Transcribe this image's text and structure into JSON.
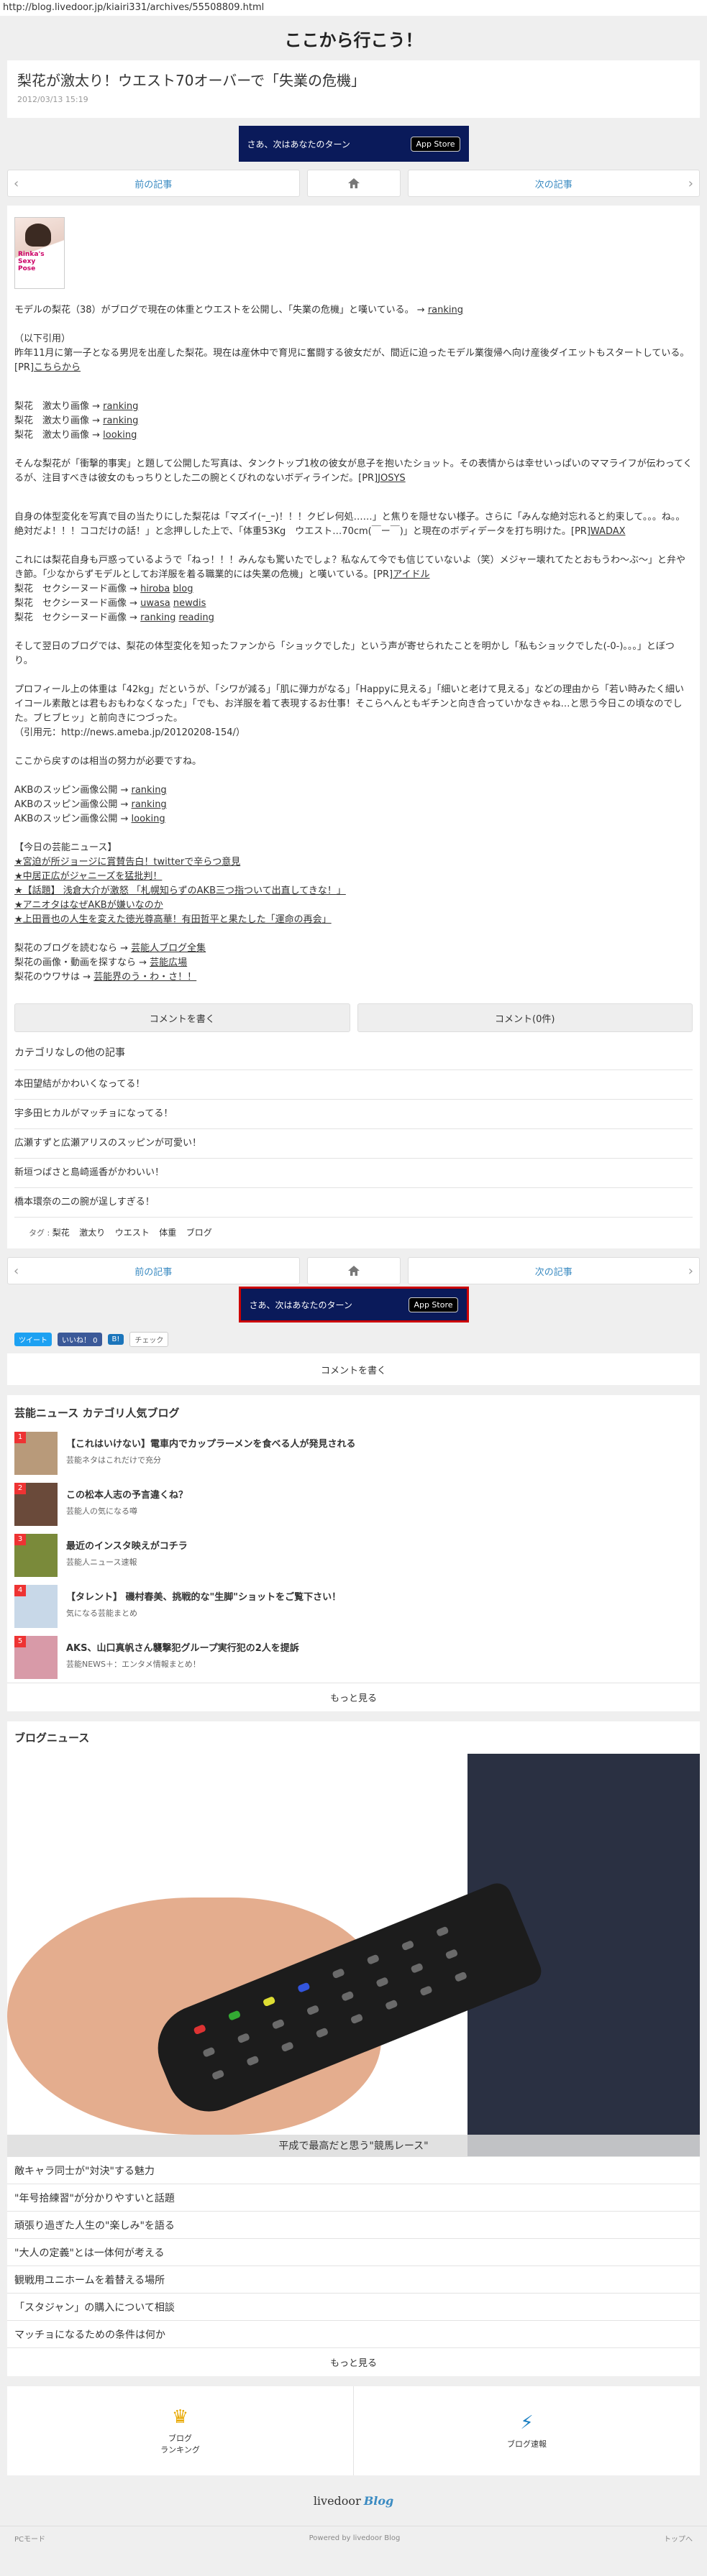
{
  "url": "http://blog.livedoor.jp/kiairi331/archives/55508809.html",
  "blog_title": "ここから行こう！",
  "article": {
    "title": "梨花が激太り！ウエスト70オーバーで「失業の危機」",
    "date": "2012/03/13 15:19",
    "thumb_label": "Rinka's Sexy Pose",
    "p1_text": "モデルの梨花（38）がブログで現在の体重とウエストを公開し、「失業の危機」と嘆いている。 → ",
    "p1_link": "ranking",
    "quote_head": "（以下引用）",
    "quote_text": "昨年11月に第一子となる男児を出産した梨花。現在は産休中で育児に奮闘する彼女だが、間近に迫ったモデル業復帰へ向け産後ダイエットもスタートしている。[PR]",
    "quote_link": "こちらから",
    "img_lines": [
      {
        "label": "梨花　激太り画像 → ",
        "link": "ranking"
      },
      {
        "label": "梨花　激太り画像 → ",
        "link": "ranking"
      },
      {
        "label": "梨花　激太り画像 → ",
        "link": "looking"
      }
    ],
    "p2_text": "そんな梨花が「衝撃的事実」と題して公開した写真は、タンクトップ1枚の彼女が息子を抱いたショット。その表情からは幸せいっぱいのママライフが伝わってくるが、注目すべきは彼女のもっちりとした二の腕とくびれのないボディラインだ。[PR]",
    "p2_link": "JOSYS",
    "p3_text": "自身の体型変化を写真で目の当たりにした梨花は「マズイ(ｰ_ｰ)！！！クビレ何処……」と焦りを隠せない様子。さらに「みんな絶対忘れると約束して。。。ね。。絶対だよ！！！ココだけの話！」と念押しした上で、「体重53Kg　ウエスト…70cm(￣ー￣)」と現在のボディデータを打ち明けた。[PR]",
    "p3_link": "WADAX",
    "p4_text": "これには梨花自身も戸惑っているようで「ねっ！！！みんなも驚いたでしょ？私なんて今でも信じていないよ（笑）メジャー壊れてたとおもうわ～ぶ～」と弁やき節。「少なからずモデルとしてお洋服を着る職業的には失業の危機」と嘆いている。[PR]",
    "p4_link": "アイドル",
    "sexy_lines": [
      {
        "label": "梨花　セクシーヌード画像 → ",
        "links": [
          "hiroba",
          "blog"
        ]
      },
      {
        "label": "梨花　セクシーヌード画像 → ",
        "links": [
          "uwasa",
          "newdis"
        ]
      },
      {
        "label": "梨花　セクシーヌード画像 → ",
        "links": [
          "ranking",
          "reading"
        ]
      }
    ],
    "p5_text": "そして翌日のブログでは、梨花の体型変化を知ったファンから「ショックでした」という声が寄せられたことを明かし「私もショックでした(-0-)。。。」とぼつり。",
    "p6_text": "プロフィール上の体重は「42kg」だというが、「シワが減る」「肌に弾力がなる」「Happyに見える」「細いと老けて見える」などの理由から「若い時みたく細いイコール素敵とは君もおもわなくなった」「でも、お洋服を着て表現するお仕事！そこらへんともギチンと向き合っていかなきゃね…と思う今日この頃なのでした。ブヒブヒッ」と前向きにつづった。",
    "p6_quote": "（引用元：http://news.ameba.jp/20120208-154/）",
    "p7_text": "ここから戻すのは相当の努力が必要ですね。",
    "akb_lines": [
      {
        "label": "AKBのスッピン画像公開 → ",
        "link": "ranking"
      },
      {
        "label": "AKBのスッピン画像公開 → ",
        "link": "ranking"
      },
      {
        "label": "AKBのスッピン画像公開 → ",
        "link": "looking"
      }
    ],
    "news_title": "【今日の芸能ニュース】",
    "news_items": [
      "★宮迫が所ジョージに賞賛告白！twitterで辛らつ意見",
      "★中居正広がジャニーズを猛批判！",
      "★【話題】 浅倉大介が激怒 「札幌知らずのAKB三つ指ついて出直してきな！」",
      "★アニオタはなぜAKBが嫌いなのか",
      "★上田晋也の人生を変えた徳光尊高華！有田哲平と果たした「運命の再会」"
    ],
    "extra_lines": [
      {
        "label": "梨花のブログを読むなら → ",
        "link": "芸能人ブログ全集"
      },
      {
        "label": "梨花の画像・動画を探すなら → ",
        "link": "芸能広場"
      },
      {
        "label": "梨花のウワサは → ",
        "link": "芸能界のう・わ・さ！！"
      }
    ],
    "comment_write": "コメントを書く",
    "comment_count": "コメント(0件)",
    "others_title": "カテゴリなしの他の記事",
    "others": [
      "本田望結がかわいくなってる！",
      "宇多田ヒカルがマッチョになってる！",
      "広瀬すずと広瀬アリスのスッピンが可愛い！",
      "新垣つばさと島崎遥香がかわいい！",
      "橋本環奈の二の腕が逞しすぎる！"
    ],
    "tags_label": "タグ :",
    "tags": [
      "梨花",
      "激太り",
      "ウエスト",
      "体重",
      "ブログ"
    ]
  },
  "ad": {
    "text": "さあ、次はあなたのターン",
    "store": "App Store"
  },
  "nav": {
    "prev": "前の記事",
    "next": "次の記事"
  },
  "social": {
    "tweet": "ツイート",
    "like": "いいね！ 0",
    "hatena": "B!",
    "check": "チェック"
  },
  "comment_box": "コメントを書く",
  "ranking": {
    "title": "芸能ニュース カテゴリ人気ブログ",
    "items": [
      {
        "rank": "1",
        "title": "【これはいけない】電車内でカップラーメンを食べる人が発見される",
        "source": "芸能ネタはこれだけで充分",
        "color": "#b89a7a"
      },
      {
        "rank": "2",
        "title": "この松本人志の予言違くね？",
        "source": "芸能人の気になる噂",
        "color": "#6a4a3a"
      },
      {
        "rank": "3",
        "title": "最近のインスタ映えがコチラ",
        "source": "芸能人ニュース速報",
        "color": "#7a8a3a"
      },
      {
        "rank": "4",
        "title": "【タレント】 磯村春美、挑戦的な\"生脚\"ショットをご覧下さい！",
        "source": "気になる芸能まとめ",
        "color": "#c8d8e8"
      },
      {
        "rank": "5",
        "title": "AKS、山口真帆さん襲撃犯グループ実行犯の2人を提訴",
        "source": "芸能NEWS＋：エンタメ情報まとめ！",
        "color": "#d89aa8"
      }
    ],
    "more": "もっと見る"
  },
  "blognews": {
    "title": "ブログニュース",
    "hero_caption": "平成で最高だと思う\"競馬レース\"",
    "items": [
      "敵キャラ同士が\"対決\"する魅力",
      "\"年号拾練習\"が分かりやすいと話題",
      "頑張り過ぎた人生の\"楽しみ\"を語る",
      "\"大人の定義\"とは一体何が考える",
      "観戦用ユニホームを着替える場所",
      "「スタジャン」の購入について相談",
      "マッチョになるための条件は何か"
    ],
    "more": "もっと見る"
  },
  "footer": {
    "ranking_line1": "ブログ",
    "ranking_line2": "ランキング",
    "flash": "ブログ速報",
    "brand": "livedoor",
    "brand_blog": "Blog",
    "pc_mode": "PCモード",
    "powered": "Powered by livedoor Blog",
    "top": "トップへ"
  }
}
